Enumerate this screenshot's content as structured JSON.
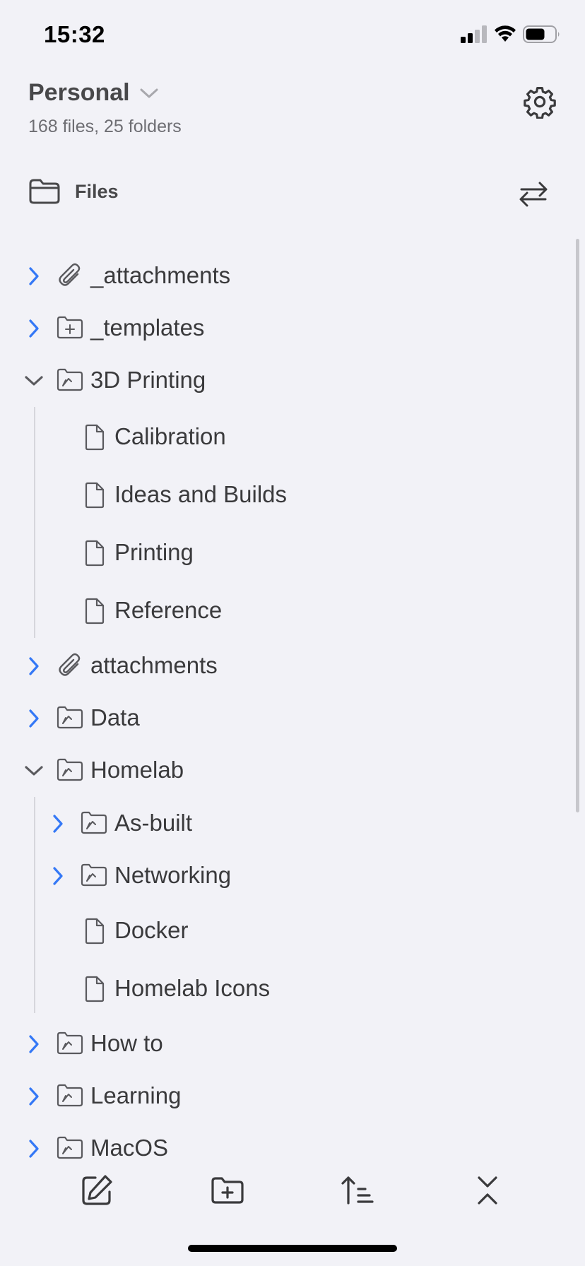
{
  "status": {
    "time": "15:32"
  },
  "header": {
    "vault_name": "Personal",
    "vault_stats": "168 files, 25 folders",
    "files_label": "Files"
  },
  "tree": [
    {
      "label": "_attachments",
      "kind": "attach-folder",
      "expanded": false,
      "depth": 0
    },
    {
      "label": "_templates",
      "kind": "template-folder",
      "expanded": false,
      "depth": 0
    },
    {
      "label": "3D Printing",
      "kind": "folder",
      "expanded": true,
      "depth": 0
    },
    {
      "label": "Calibration",
      "kind": "file",
      "depth": 1
    },
    {
      "label": "Ideas and Builds",
      "kind": "file",
      "depth": 1
    },
    {
      "label": "Printing",
      "kind": "file",
      "depth": 1
    },
    {
      "label": "Reference",
      "kind": "file",
      "depth": 1
    },
    {
      "label": "attachments",
      "kind": "attach-folder",
      "expanded": false,
      "depth": 0
    },
    {
      "label": "Data",
      "kind": "folder",
      "expanded": false,
      "depth": 0
    },
    {
      "label": "Homelab",
      "kind": "folder",
      "expanded": true,
      "depth": 0
    },
    {
      "label": "As-built",
      "kind": "folder",
      "expanded": false,
      "depth": 1
    },
    {
      "label": "Networking",
      "kind": "folder",
      "expanded": false,
      "depth": 1
    },
    {
      "label": "Docker",
      "kind": "file",
      "depth": 1
    },
    {
      "label": "Homelab Icons",
      "kind": "file",
      "depth": 1
    },
    {
      "label": "How to",
      "kind": "folder",
      "expanded": false,
      "depth": 0
    },
    {
      "label": "Learning",
      "kind": "folder",
      "expanded": false,
      "depth": 0
    },
    {
      "label": "MacOS",
      "kind": "folder",
      "expanded": false,
      "depth": 0
    }
  ],
  "colors": {
    "accent": "#3478f6",
    "icon": "#5a5a5e"
  },
  "icons": {
    "gear": "gear-icon",
    "swap": "swap-arrows-icon",
    "new_note": "new-note-icon",
    "new_folder": "new-folder-icon",
    "sort": "sort-icon",
    "collapse": "collapse-all-icon"
  }
}
